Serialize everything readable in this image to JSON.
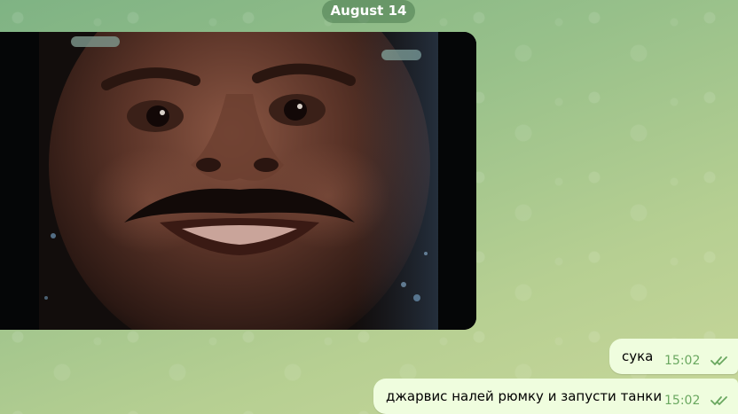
{
  "chat": {
    "date_separator": "August 14",
    "messages": [
      {
        "text": "сука",
        "time": "15:02",
        "status_icon": "double-check-icon"
      },
      {
        "text": "джарвис налей рюмку и запусти танки",
        "time": "15:02",
        "status_icon": "double-check-icon"
      }
    ],
    "photo_icon": "photo-message-image"
  },
  "colors": {
    "outgoing_bubble": "#effdde",
    "time_and_checks": "#6aa860",
    "wallpaper": "#97c08a"
  }
}
